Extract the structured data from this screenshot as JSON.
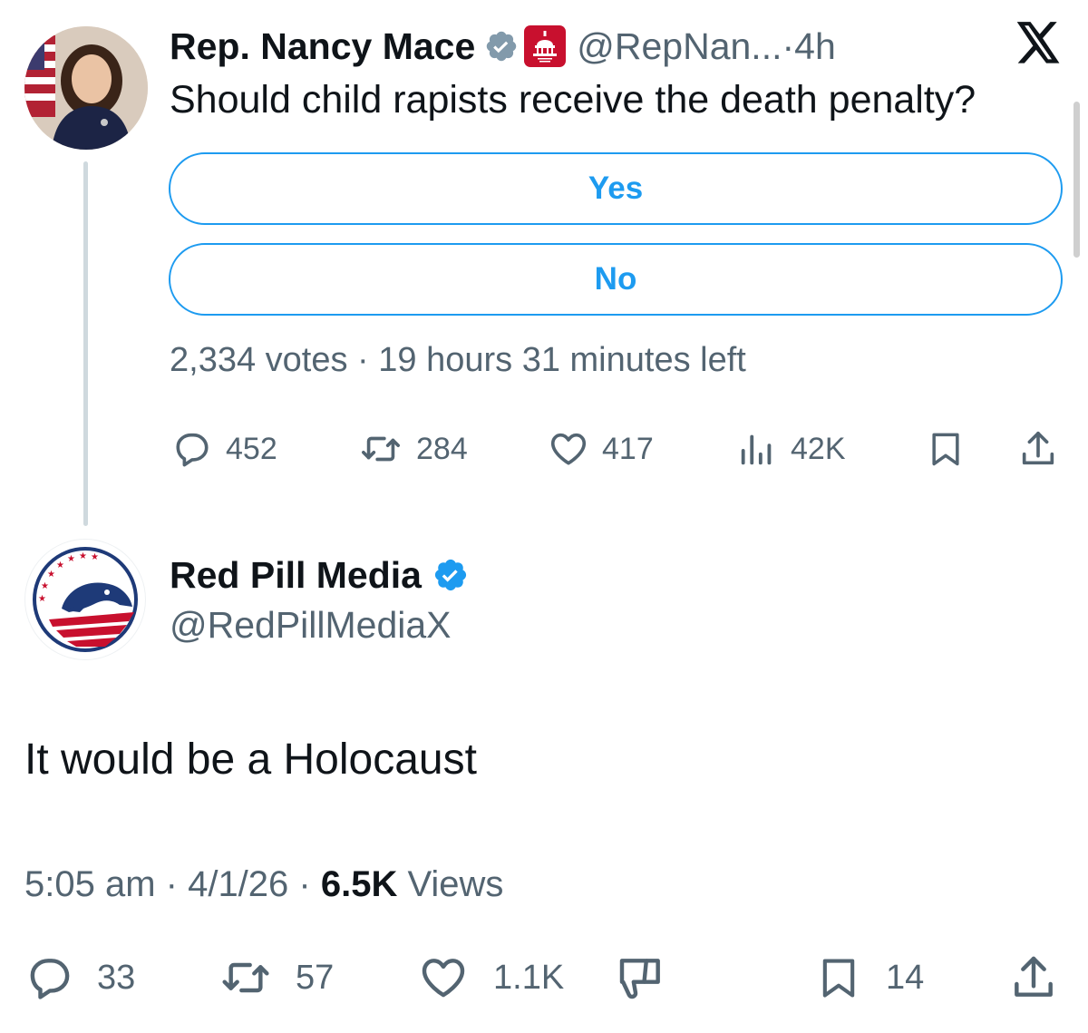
{
  "quoted_tweet": {
    "author_name": "Rep. Nancy Mace",
    "handle": "@RepNan...",
    "time_sep": " · ",
    "time": "4h",
    "text": "Should child rapists receive the death penalty?",
    "poll": {
      "options": [
        "Yes",
        "No"
      ],
      "votes": "2,334 votes",
      "sep": " · ",
      "time_left": "19 hours 31 minutes left"
    },
    "stats": {
      "replies": "452",
      "reposts": "284",
      "likes": "417",
      "views": "42K"
    }
  },
  "main_tweet": {
    "author_name": "Red Pill Media",
    "handle": "@RedPillMediaX",
    "text": "It would be a Holocaust",
    "time": "5:05 am",
    "sep1": " · ",
    "date": "4/1/26",
    "sep2": " · ",
    "views_count": "6.5K",
    "views_label": " Views",
    "stats": {
      "replies": "33",
      "reposts": "57",
      "likes": "1.1K",
      "bookmarks": "14"
    }
  },
  "colors": {
    "accent": "#1d9bf0",
    "muted_text": "#536471",
    "primary_text": "#0f1419",
    "thread_line": "#cfd9de",
    "gov_badge": "#c8102e"
  },
  "icons": [
    "x-logo-icon",
    "verified-grey-icon",
    "gov-capitol-icon",
    "verified-blue-icon",
    "reply-icon",
    "repost-icon",
    "like-icon",
    "views-icon",
    "bookmark-icon",
    "share-icon",
    "dislike-icon"
  ]
}
